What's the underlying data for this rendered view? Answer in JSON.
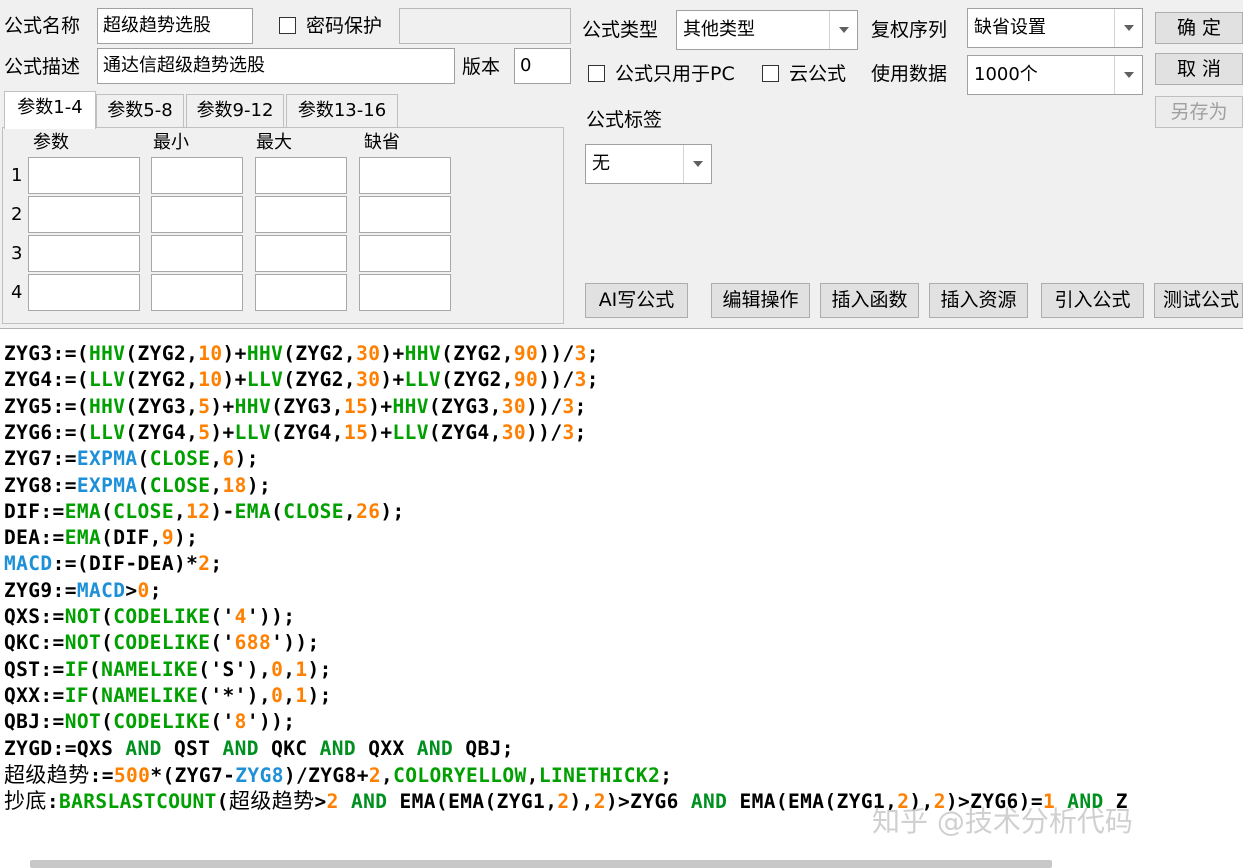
{
  "form": {
    "name_label": "公式名称",
    "name_value": "超级趋势选股",
    "password_label": "密码保护",
    "password_value": "",
    "desc_label": "公式描述",
    "desc_value": "通达信超级趋势选股",
    "version_label": "版本",
    "version_value": "0",
    "type_label": "公式类型",
    "type_value": "其他类型",
    "rights_label": "复权序列",
    "rights_value": "缺省设置",
    "pc_only_label": "公式只用于PC",
    "cloud_label": "云公式",
    "data_label": "使用数据",
    "data_value": "1000个",
    "tag_label": "公式标签",
    "tag_value": "无"
  },
  "buttons": {
    "ok": "确  定",
    "cancel": "取  消",
    "save_as": "另存为",
    "ai_write": "AI写公式",
    "edit_ops": "编辑操作",
    "insert_func": "插入函数",
    "insert_res": "插入资源",
    "import_formula": "引入公式",
    "test_formula": "测试公式"
  },
  "param_tabs": [
    "参数1-4",
    "参数5-8",
    "参数9-12",
    "参数13-16"
  ],
  "param_table": {
    "headers": [
      "参数",
      "最小",
      "最大",
      "缺省"
    ],
    "rows": [
      "1",
      "2",
      "3",
      "4"
    ]
  },
  "code": [
    [
      [
        "id",
        "ZYG3:=("
      ],
      [
        "fn",
        "HHV"
      ],
      [
        "id",
        "(ZYG2,"
      ],
      [
        "num",
        "10"
      ],
      [
        "id",
        ")+"
      ],
      [
        "fn",
        "HHV"
      ],
      [
        "id",
        "(ZYG2,"
      ],
      [
        "num",
        "30"
      ],
      [
        "id",
        ")+"
      ],
      [
        "fn",
        "HHV"
      ],
      [
        "id",
        "(ZYG2,"
      ],
      [
        "num",
        "90"
      ],
      [
        "id",
        "))/"
      ],
      [
        "num",
        "3"
      ],
      [
        "id",
        ";"
      ]
    ],
    [
      [
        "id",
        "ZYG4:=("
      ],
      [
        "fn",
        "LLV"
      ],
      [
        "id",
        "(ZYG2,"
      ],
      [
        "num",
        "10"
      ],
      [
        "id",
        ")+"
      ],
      [
        "fn",
        "LLV"
      ],
      [
        "id",
        "(ZYG2,"
      ],
      [
        "num",
        "30"
      ],
      [
        "id",
        ")+"
      ],
      [
        "fn",
        "LLV"
      ],
      [
        "id",
        "(ZYG2,"
      ],
      [
        "num",
        "90"
      ],
      [
        "id",
        "))/"
      ],
      [
        "num",
        "3"
      ],
      [
        "id",
        ";"
      ]
    ],
    [
      [
        "id",
        "ZYG5:=("
      ],
      [
        "fn",
        "HHV"
      ],
      [
        "id",
        "(ZYG3,"
      ],
      [
        "num",
        "5"
      ],
      [
        "id",
        ")+"
      ],
      [
        "fn",
        "HHV"
      ],
      [
        "id",
        "(ZYG3,"
      ],
      [
        "num",
        "15"
      ],
      [
        "id",
        ")+"
      ],
      [
        "fn",
        "HHV"
      ],
      [
        "id",
        "(ZYG3,"
      ],
      [
        "num",
        "30"
      ],
      [
        "id",
        "))/"
      ],
      [
        "num",
        "3"
      ],
      [
        "id",
        ";"
      ]
    ],
    [
      [
        "id",
        "ZYG6:=("
      ],
      [
        "fn",
        "LLV"
      ],
      [
        "id",
        "(ZYG4,"
      ],
      [
        "num",
        "5"
      ],
      [
        "id",
        ")+"
      ],
      [
        "fn",
        "LLV"
      ],
      [
        "id",
        "(ZYG4,"
      ],
      [
        "num",
        "15"
      ],
      [
        "id",
        ")+"
      ],
      [
        "fn",
        "LLV"
      ],
      [
        "id",
        "(ZYG4,"
      ],
      [
        "num",
        "30"
      ],
      [
        "id",
        "))/"
      ],
      [
        "num",
        "3"
      ],
      [
        "id",
        ";"
      ]
    ],
    [
      [
        "id",
        "ZYG7:="
      ],
      [
        "blue",
        "EXPMA"
      ],
      [
        "id",
        "("
      ],
      [
        "fn",
        "CLOSE"
      ],
      [
        "id",
        ","
      ],
      [
        "num",
        "6"
      ],
      [
        "id",
        ");"
      ]
    ],
    [
      [
        "id",
        "ZYG8:="
      ],
      [
        "blue",
        "EXPMA"
      ],
      [
        "id",
        "("
      ],
      [
        "fn",
        "CLOSE"
      ],
      [
        "id",
        ","
      ],
      [
        "num",
        "18"
      ],
      [
        "id",
        ");"
      ]
    ],
    [
      [
        "id",
        "DIF:="
      ],
      [
        "fn",
        "EMA"
      ],
      [
        "id",
        "("
      ],
      [
        "fn",
        "CLOSE"
      ],
      [
        "id",
        ","
      ],
      [
        "num",
        "12"
      ],
      [
        "id",
        ")-"
      ],
      [
        "fn",
        "EMA"
      ],
      [
        "id",
        "("
      ],
      [
        "fn",
        "CLOSE"
      ],
      [
        "id",
        ","
      ],
      [
        "num",
        "26"
      ],
      [
        "id",
        ");"
      ]
    ],
    [
      [
        "id",
        "DEA:="
      ],
      [
        "fn",
        "EMA"
      ],
      [
        "id",
        "(DIF,"
      ],
      [
        "num",
        "9"
      ],
      [
        "id",
        ");"
      ]
    ],
    [
      [
        "blue",
        "MACD"
      ],
      [
        "id",
        ":=(DIF-DEA)*"
      ],
      [
        "num",
        "2"
      ],
      [
        "id",
        ";"
      ]
    ],
    [
      [
        "id",
        "ZYG9:="
      ],
      [
        "blue",
        "MACD"
      ],
      [
        "id",
        ">"
      ],
      [
        "num",
        "0"
      ],
      [
        "id",
        ";"
      ]
    ],
    [
      [
        "id",
        "QXS:="
      ],
      [
        "fn",
        "NOT"
      ],
      [
        "id",
        "("
      ],
      [
        "fn",
        "CODELIKE"
      ],
      [
        "id",
        "('"
      ],
      [
        "num",
        "4"
      ],
      [
        "id",
        "'));"
      ]
    ],
    [
      [
        "id",
        "QKC:="
      ],
      [
        "fn",
        "NOT"
      ],
      [
        "id",
        "("
      ],
      [
        "fn",
        "CODELIKE"
      ],
      [
        "id",
        "('"
      ],
      [
        "num",
        "688"
      ],
      [
        "id",
        "'));"
      ]
    ],
    [
      [
        "id",
        "QST:="
      ],
      [
        "fn",
        "IF"
      ],
      [
        "id",
        "("
      ],
      [
        "fn",
        "NAMELIKE"
      ],
      [
        "id",
        "('S'),"
      ],
      [
        "num",
        "0"
      ],
      [
        "id",
        ","
      ],
      [
        "num",
        "1"
      ],
      [
        "id",
        ");"
      ]
    ],
    [
      [
        "id",
        "QXX:="
      ],
      [
        "fn",
        "IF"
      ],
      [
        "id",
        "("
      ],
      [
        "fn",
        "NAMELIKE"
      ],
      [
        "id",
        "('*'),"
      ],
      [
        "num",
        "0"
      ],
      [
        "id",
        ","
      ],
      [
        "num",
        "1"
      ],
      [
        "id",
        ");"
      ]
    ],
    [
      [
        "id",
        "QBJ:="
      ],
      [
        "fn",
        "NOT"
      ],
      [
        "id",
        "("
      ],
      [
        "fn",
        "CODELIKE"
      ],
      [
        "id",
        "('"
      ],
      [
        "num",
        "8"
      ],
      [
        "id",
        "'));"
      ]
    ],
    [
      [
        "id",
        "ZYGD:=QXS "
      ],
      [
        "kw",
        "AND"
      ],
      [
        "id",
        " QST "
      ],
      [
        "kw",
        "AND"
      ],
      [
        "id",
        " QKC "
      ],
      [
        "kw",
        "AND"
      ],
      [
        "id",
        " QXX "
      ],
      [
        "kw",
        "AND"
      ],
      [
        "id",
        " QBJ;"
      ]
    ],
    [
      [
        "cn",
        "超级趋势"
      ],
      [
        "id",
        ":="
      ],
      [
        "num",
        "500"
      ],
      [
        "id",
        "*(ZYG7-"
      ],
      [
        "blue",
        "ZYG8"
      ],
      [
        "id",
        ")/ZYG8+"
      ],
      [
        "num",
        "2"
      ],
      [
        "id",
        ","
      ],
      [
        "fn",
        "COLORYELLOW"
      ],
      [
        "id",
        ","
      ],
      [
        "fn",
        "LINETHICK2"
      ],
      [
        "id",
        ";"
      ]
    ],
    [
      [
        "cn",
        "抄底"
      ],
      [
        "id",
        ":"
      ],
      [
        "fn",
        "BARSLASTCOUNT"
      ],
      [
        "id",
        "("
      ],
      [
        "cn",
        "超级趋势"
      ],
      [
        "id",
        ">"
      ],
      [
        "num",
        "2"
      ],
      [
        "id",
        " "
      ],
      [
        "kw",
        "AND"
      ],
      [
        "id",
        " EMA(EMA(ZYG1,"
      ],
      [
        "num",
        "2"
      ],
      [
        "id",
        "),"
      ],
      [
        "num",
        "2"
      ],
      [
        "id",
        ")>ZYG6 "
      ],
      [
        "kw",
        "AND"
      ],
      [
        "id",
        " EMA(EMA(ZYG1,"
      ],
      [
        "num",
        "2"
      ],
      [
        "id",
        "),"
      ],
      [
        "num",
        "2"
      ],
      [
        "id",
        ")>ZYG6)="
      ],
      [
        "num",
        "1"
      ],
      [
        "id",
        " "
      ],
      [
        "kw",
        "AND"
      ],
      [
        "id",
        " Z"
      ]
    ]
  ],
  "watermark": "知乎 @技术分析代码",
  "colors": {
    "function": "#00a000",
    "number": "#ff8000",
    "keyword": "#009020",
    "blue": "#1e90d8"
  }
}
